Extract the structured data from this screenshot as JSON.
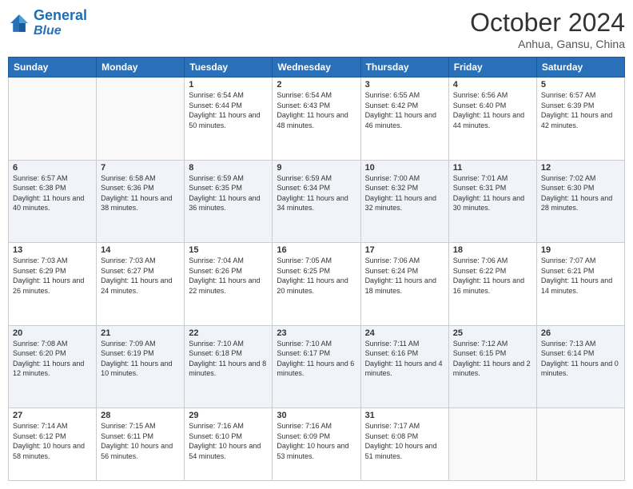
{
  "header": {
    "logo_line1": "General",
    "logo_line2": "Blue",
    "month": "October 2024",
    "location": "Anhua, Gansu, China"
  },
  "weekdays": [
    "Sunday",
    "Monday",
    "Tuesday",
    "Wednesday",
    "Thursday",
    "Friday",
    "Saturday"
  ],
  "weeks": [
    [
      {
        "day": "",
        "info": ""
      },
      {
        "day": "",
        "info": ""
      },
      {
        "day": "1",
        "info": "Sunrise: 6:54 AM\nSunset: 6:44 PM\nDaylight: 11 hours and 50 minutes."
      },
      {
        "day": "2",
        "info": "Sunrise: 6:54 AM\nSunset: 6:43 PM\nDaylight: 11 hours and 48 minutes."
      },
      {
        "day": "3",
        "info": "Sunrise: 6:55 AM\nSunset: 6:42 PM\nDaylight: 11 hours and 46 minutes."
      },
      {
        "day": "4",
        "info": "Sunrise: 6:56 AM\nSunset: 6:40 PM\nDaylight: 11 hours and 44 minutes."
      },
      {
        "day": "5",
        "info": "Sunrise: 6:57 AM\nSunset: 6:39 PM\nDaylight: 11 hours and 42 minutes."
      }
    ],
    [
      {
        "day": "6",
        "info": "Sunrise: 6:57 AM\nSunset: 6:38 PM\nDaylight: 11 hours and 40 minutes."
      },
      {
        "day": "7",
        "info": "Sunrise: 6:58 AM\nSunset: 6:36 PM\nDaylight: 11 hours and 38 minutes."
      },
      {
        "day": "8",
        "info": "Sunrise: 6:59 AM\nSunset: 6:35 PM\nDaylight: 11 hours and 36 minutes."
      },
      {
        "day": "9",
        "info": "Sunrise: 6:59 AM\nSunset: 6:34 PM\nDaylight: 11 hours and 34 minutes."
      },
      {
        "day": "10",
        "info": "Sunrise: 7:00 AM\nSunset: 6:32 PM\nDaylight: 11 hours and 32 minutes."
      },
      {
        "day": "11",
        "info": "Sunrise: 7:01 AM\nSunset: 6:31 PM\nDaylight: 11 hours and 30 minutes."
      },
      {
        "day": "12",
        "info": "Sunrise: 7:02 AM\nSunset: 6:30 PM\nDaylight: 11 hours and 28 minutes."
      }
    ],
    [
      {
        "day": "13",
        "info": "Sunrise: 7:03 AM\nSunset: 6:29 PM\nDaylight: 11 hours and 26 minutes."
      },
      {
        "day": "14",
        "info": "Sunrise: 7:03 AM\nSunset: 6:27 PM\nDaylight: 11 hours and 24 minutes."
      },
      {
        "day": "15",
        "info": "Sunrise: 7:04 AM\nSunset: 6:26 PM\nDaylight: 11 hours and 22 minutes."
      },
      {
        "day": "16",
        "info": "Sunrise: 7:05 AM\nSunset: 6:25 PM\nDaylight: 11 hours and 20 minutes."
      },
      {
        "day": "17",
        "info": "Sunrise: 7:06 AM\nSunset: 6:24 PM\nDaylight: 11 hours and 18 minutes."
      },
      {
        "day": "18",
        "info": "Sunrise: 7:06 AM\nSunset: 6:22 PM\nDaylight: 11 hours and 16 minutes."
      },
      {
        "day": "19",
        "info": "Sunrise: 7:07 AM\nSunset: 6:21 PM\nDaylight: 11 hours and 14 minutes."
      }
    ],
    [
      {
        "day": "20",
        "info": "Sunrise: 7:08 AM\nSunset: 6:20 PM\nDaylight: 11 hours and 12 minutes."
      },
      {
        "day": "21",
        "info": "Sunrise: 7:09 AM\nSunset: 6:19 PM\nDaylight: 11 hours and 10 minutes."
      },
      {
        "day": "22",
        "info": "Sunrise: 7:10 AM\nSunset: 6:18 PM\nDaylight: 11 hours and 8 minutes."
      },
      {
        "day": "23",
        "info": "Sunrise: 7:10 AM\nSunset: 6:17 PM\nDaylight: 11 hours and 6 minutes."
      },
      {
        "day": "24",
        "info": "Sunrise: 7:11 AM\nSunset: 6:16 PM\nDaylight: 11 hours and 4 minutes."
      },
      {
        "day": "25",
        "info": "Sunrise: 7:12 AM\nSunset: 6:15 PM\nDaylight: 11 hours and 2 minutes."
      },
      {
        "day": "26",
        "info": "Sunrise: 7:13 AM\nSunset: 6:14 PM\nDaylight: 11 hours and 0 minutes."
      }
    ],
    [
      {
        "day": "27",
        "info": "Sunrise: 7:14 AM\nSunset: 6:12 PM\nDaylight: 10 hours and 58 minutes."
      },
      {
        "day": "28",
        "info": "Sunrise: 7:15 AM\nSunset: 6:11 PM\nDaylight: 10 hours and 56 minutes."
      },
      {
        "day": "29",
        "info": "Sunrise: 7:16 AM\nSunset: 6:10 PM\nDaylight: 10 hours and 54 minutes."
      },
      {
        "day": "30",
        "info": "Sunrise: 7:16 AM\nSunset: 6:09 PM\nDaylight: 10 hours and 53 minutes."
      },
      {
        "day": "31",
        "info": "Sunrise: 7:17 AM\nSunset: 6:08 PM\nDaylight: 10 hours and 51 minutes."
      },
      {
        "day": "",
        "info": ""
      },
      {
        "day": "",
        "info": ""
      }
    ]
  ]
}
